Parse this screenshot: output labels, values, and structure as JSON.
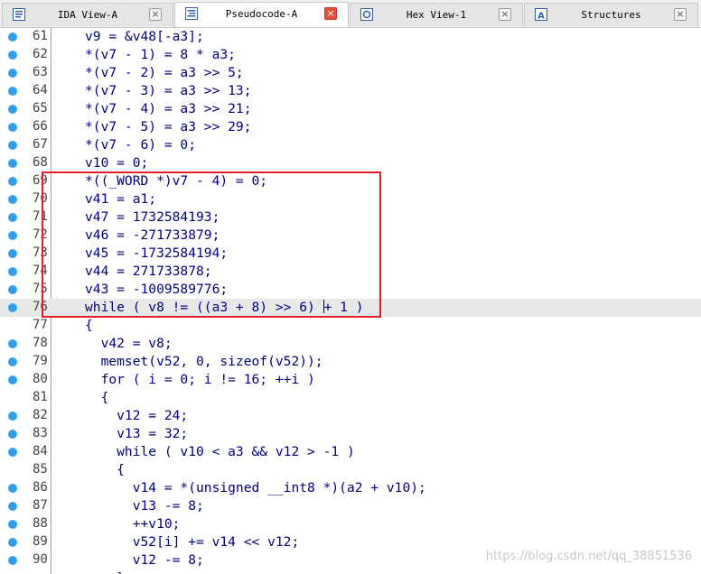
{
  "tabs": [
    {
      "name": "ida-view",
      "label": "IDA View-A",
      "active": false,
      "icon": "ida-view-icon"
    },
    {
      "name": "pseudocode",
      "label": "Pseudocode-A",
      "active": true,
      "icon": "pseudocode-icon"
    },
    {
      "name": "hex-view",
      "label": "Hex View-1",
      "active": false,
      "icon": "hex-view-icon"
    },
    {
      "name": "structures",
      "label": "Structures",
      "active": false,
      "icon": "structures-icon"
    }
  ],
  "close_glyph": "×",
  "code_lines": [
    {
      "num": "61",
      "dot": true,
      "text": "v9 = &v48[-a3];"
    },
    {
      "num": "62",
      "dot": true,
      "text": "*(v7 - 1) = 8 * a3;"
    },
    {
      "num": "63",
      "dot": true,
      "text": "*(v7 - 2) = a3 >> 5;"
    },
    {
      "num": "64",
      "dot": true,
      "text": "*(v7 - 3) = a3 >> 13;"
    },
    {
      "num": "65",
      "dot": true,
      "text": "*(v7 - 4) = a3 >> 21;"
    },
    {
      "num": "66",
      "dot": true,
      "text": "*(v7 - 5) = a3 >> 29;"
    },
    {
      "num": "67",
      "dot": true,
      "text": "*(v7 - 6) = 0;"
    },
    {
      "num": "68",
      "dot": true,
      "text": "v10 = 0;"
    },
    {
      "num": "69",
      "dot": true,
      "text": "*((_WORD *)v7 - 4) = 0;"
    },
    {
      "num": "70",
      "dot": true,
      "text": "v41 = a1;"
    },
    {
      "num": "71",
      "dot": true,
      "text": "v47 = 1732584193;"
    },
    {
      "num": "72",
      "dot": true,
      "text": "v46 = -271733879;"
    },
    {
      "num": "73",
      "dot": true,
      "text": "v45 = -1732584194;"
    },
    {
      "num": "74",
      "dot": true,
      "text": "v44 = 271733878;"
    },
    {
      "num": "75",
      "dot": true,
      "text": "v43 = -1009589776;"
    },
    {
      "num": "76",
      "dot": true,
      "text": "while ( v8 != ((a3 + 8) >> 6) + 1 )",
      "highlight": true,
      "caret_after": "while ( v8 != ((a3 + 8) >> 6) "
    },
    {
      "num": "77",
      "dot": false,
      "text": "{"
    },
    {
      "num": "78",
      "dot": true,
      "text": "  v42 = v8;"
    },
    {
      "num": "79",
      "dot": true,
      "text": "  memset(v52, 0, sizeof(v52));"
    },
    {
      "num": "80",
      "dot": true,
      "text": "  for ( i = 0; i != 16; ++i )"
    },
    {
      "num": "81",
      "dot": false,
      "text": "  {"
    },
    {
      "num": "82",
      "dot": true,
      "text": "    v12 = 24;"
    },
    {
      "num": "83",
      "dot": true,
      "text": "    v13 = 32;"
    },
    {
      "num": "84",
      "dot": true,
      "text": "    while ( v10 < a3 && v12 > -1 )"
    },
    {
      "num": "85",
      "dot": false,
      "text": "    {"
    },
    {
      "num": "86",
      "dot": true,
      "text": "      v14 = *(unsigned __int8 *)(a2 + v10);"
    },
    {
      "num": "87",
      "dot": true,
      "text": "      v13 -= 8;"
    },
    {
      "num": "88",
      "dot": true,
      "text": "      ++v10;"
    },
    {
      "num": "89",
      "dot": true,
      "text": "      v52[i] += v14 << v12;"
    },
    {
      "num": "90",
      "dot": true,
      "text": "      v12 -= 8;"
    },
    {
      "num": "",
      "dot": false,
      "text": "    }"
    }
  ],
  "watermark": "https://blog.csdn.net/qq_38851536",
  "colors": {
    "code": "#000080",
    "dot": "#30a0ee",
    "annotation": "#e0202a",
    "active_close": "#e9503c"
  }
}
